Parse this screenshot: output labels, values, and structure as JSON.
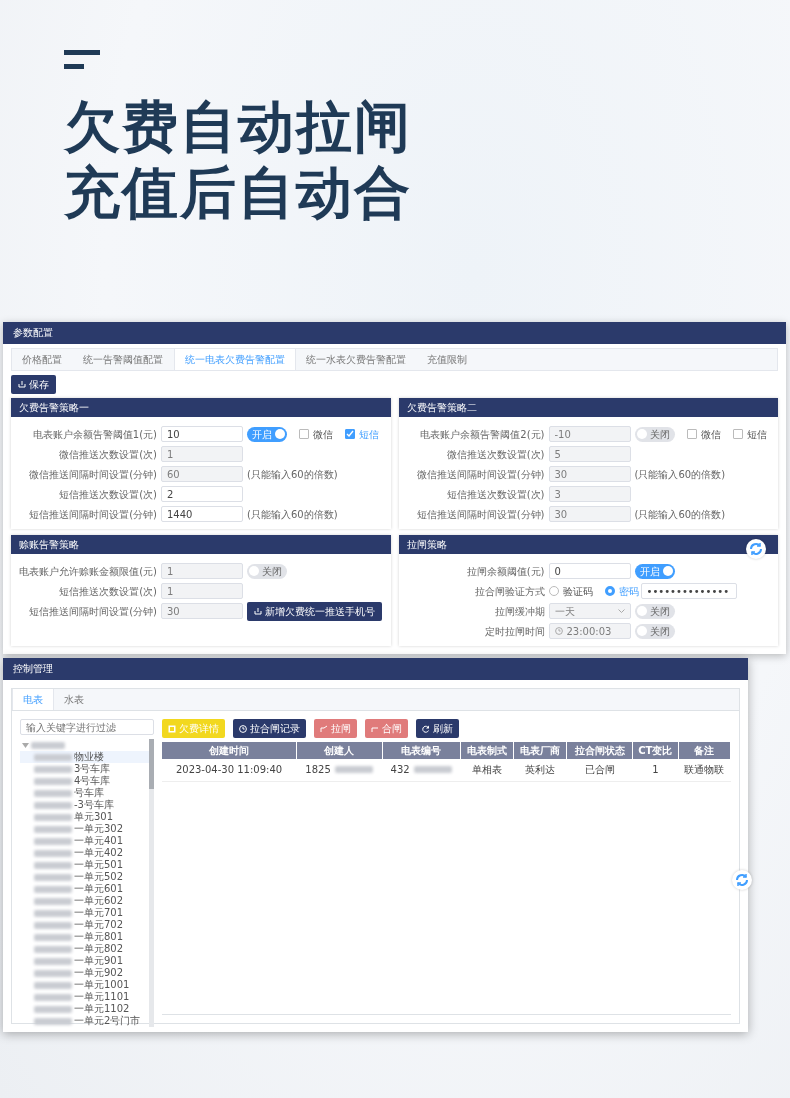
{
  "headline": {
    "lines": [
      "欠费自动拉闸",
      "充值后自动合"
    ]
  },
  "config_window": {
    "title": "参数配置",
    "tabs": [
      {
        "label": "价格配置",
        "selected": false
      },
      {
        "label": "统一告警阈值配置",
        "selected": false
      },
      {
        "label": "统一电表欠费告警配置",
        "selected": true
      },
      {
        "label": "统一水表欠费告警配置",
        "selected": false
      },
      {
        "label": "充值限制",
        "selected": false
      }
    ],
    "save_button": "保存",
    "panels": [
      {
        "title": "欠费告警策略一",
        "rows": [
          {
            "kind": "input",
            "label": "电表账户余额告警阈值1(元)",
            "value": "10",
            "disabled": false,
            "toggle": {
              "label": "开启",
              "on": true
            },
            "checks": [
              {
                "label": "微信",
                "checked": false
              },
              {
                "label": "短信",
                "checked": true
              }
            ]
          },
          {
            "kind": "input",
            "label": "微信推送次数设置(次)",
            "value": "1",
            "disabled": true
          },
          {
            "kind": "input",
            "label": "微信推送间隔时间设置(分钟)",
            "value": "60",
            "disabled": true,
            "hint": "(只能输入60的倍数)"
          },
          {
            "kind": "input",
            "label": "短信推送次数设置(次)",
            "value": "2",
            "disabled": false
          },
          {
            "kind": "input",
            "label": "短信推送间隔时间设置(分钟)",
            "value": "1440",
            "disabled": false,
            "hint": "(只能输入60的倍数)"
          }
        ]
      },
      {
        "title": "欠费告警策略二",
        "rows": [
          {
            "kind": "input",
            "label": "电表账户余额告警阈值2(元)",
            "value": "-10",
            "disabled": true,
            "toggle": {
              "label": "关闭",
              "on": false
            },
            "checks": [
              {
                "label": "微信",
                "checked": false
              },
              {
                "label": "短信",
                "checked": false
              }
            ]
          },
          {
            "kind": "input",
            "label": "微信推送次数设置(次)",
            "value": "5",
            "disabled": true
          },
          {
            "kind": "input",
            "label": "微信推送间隔时间设置(分钟)",
            "value": "30",
            "disabled": true,
            "hint": "(只能输入60的倍数)"
          },
          {
            "kind": "input",
            "label": "短信推送次数设置(次)",
            "value": "3",
            "disabled": true
          },
          {
            "kind": "input",
            "label": "短信推送间隔时间设置(分钟)",
            "value": "30",
            "disabled": true,
            "hint": "(只能输入60的倍数)"
          }
        ]
      },
      {
        "title": "赊账告警策略",
        "rows": [
          {
            "kind": "input",
            "label": "电表账户允许赊账金额限值(元)",
            "value": "1",
            "disabled": true,
            "toggle": {
              "label": "关闭",
              "on": false
            }
          },
          {
            "kind": "input",
            "label": "短信推送次数设置(次)",
            "value": "1",
            "disabled": true
          },
          {
            "kind": "input",
            "label": "短信推送间隔时间设置(分钟)",
            "value": "30",
            "disabled": true,
            "action_button": "新增欠费统一推送手机号"
          }
        ]
      },
      {
        "title": "拉闸策略",
        "rows": [
          {
            "kind": "input",
            "label": "拉闸余额阈值(元)",
            "value": "0",
            "disabled": false,
            "toggle": {
              "label": "开启",
              "on": true
            }
          },
          {
            "kind": "radio",
            "label": "拉合闸验证方式",
            "options": [
              {
                "label": "验证码",
                "selected": false
              },
              {
                "label": "密码",
                "selected": true
              }
            ],
            "password": "••••••••••••••"
          },
          {
            "kind": "select",
            "label": "拉闸缓冲期",
            "value": "一天",
            "disabled": true,
            "toggle": {
              "label": "关闭",
              "on": false
            }
          },
          {
            "kind": "time",
            "label": "定时拉闸时间",
            "value": "23:00:03",
            "disabled": true,
            "toggle": {
              "label": "关闭",
              "on": false
            }
          }
        ]
      }
    ]
  },
  "control_window": {
    "title": "控制管理",
    "tabs": [
      {
        "label": "电表",
        "selected": true
      },
      {
        "label": "水表",
        "selected": false
      }
    ],
    "filter": {
      "placeholder": "输入关键字进行过滤"
    },
    "tree": {
      "expanded": true,
      "blurred": true,
      "children": [
        {
          "label": "物业楼",
          "blurred": true,
          "selected": true
        },
        {
          "label": "3号车库",
          "blurred": true,
          "selected": false
        },
        {
          "label": "4号车库",
          "blurred": true,
          "selected": false
        },
        {
          "label": "号车库",
          "blurred": true,
          "selected": false
        },
        {
          "label": "-3号车库",
          "blurred": true,
          "selected": false
        },
        {
          "label": "单元301",
          "blurred": true,
          "selected": false
        },
        {
          "label": "一单元302",
          "blurred": true,
          "selected": false
        },
        {
          "label": "一单元401",
          "blurred": true,
          "selected": false
        },
        {
          "label": "一单元402",
          "blurred": true,
          "selected": false
        },
        {
          "label": "一单元501",
          "blurred": true,
          "selected": false
        },
        {
          "label": "一单元502",
          "blurred": true,
          "selected": false
        },
        {
          "label": "一单元601",
          "blurred": true,
          "selected": false
        },
        {
          "label": "一单元602",
          "blurred": true,
          "selected": false
        },
        {
          "label": "一单元701",
          "blurred": true,
          "selected": false
        },
        {
          "label": "一单元702",
          "blurred": true,
          "selected": false
        },
        {
          "label": "一单元801",
          "blurred": true,
          "selected": false
        },
        {
          "label": "一单元802",
          "blurred": true,
          "selected": false
        },
        {
          "label": "一单元901",
          "blurred": true,
          "selected": false
        },
        {
          "label": "一单元902",
          "blurred": true,
          "selected": false
        },
        {
          "label": "一单元1001",
          "blurred": true,
          "selected": false
        },
        {
          "label": "一单元1101",
          "blurred": true,
          "selected": false
        },
        {
          "label": "一单元1102",
          "blurred": true,
          "selected": false
        },
        {
          "label": "一单元2号门市",
          "blurred": true,
          "selected": false
        }
      ]
    },
    "toolbar": [
      {
        "label": "欠费详情",
        "kind": "warning"
      },
      {
        "label": "拉合闸记录",
        "kind": "primary"
      },
      {
        "label": "拉闸",
        "kind": "danger"
      },
      {
        "label": "合闸",
        "kind": "danger"
      },
      {
        "label": "刷新",
        "kind": "primary"
      }
    ],
    "table": {
      "columns": [
        "创建时间",
        "创建人",
        "电表编号",
        "电表制式",
        "电表厂商",
        "拉合闸状态",
        "CT变比",
        "备注"
      ],
      "rows": [
        {
          "cells": [
            {
              "text": "2023-04-30 11:09:40",
              "blurred": false
            },
            {
              "text": "1825",
              "blurred": true
            },
            {
              "text": "432",
              "blurred": true
            },
            {
              "text": "单相表",
              "blurred": false
            },
            {
              "text": "英利达",
              "blurred": false
            },
            {
              "text": "已合闸",
              "blurred": false
            },
            {
              "text": "1",
              "blurred": false
            },
            {
              "text": "联通物联",
              "blurred": false
            }
          ]
        }
      ]
    }
  }
}
